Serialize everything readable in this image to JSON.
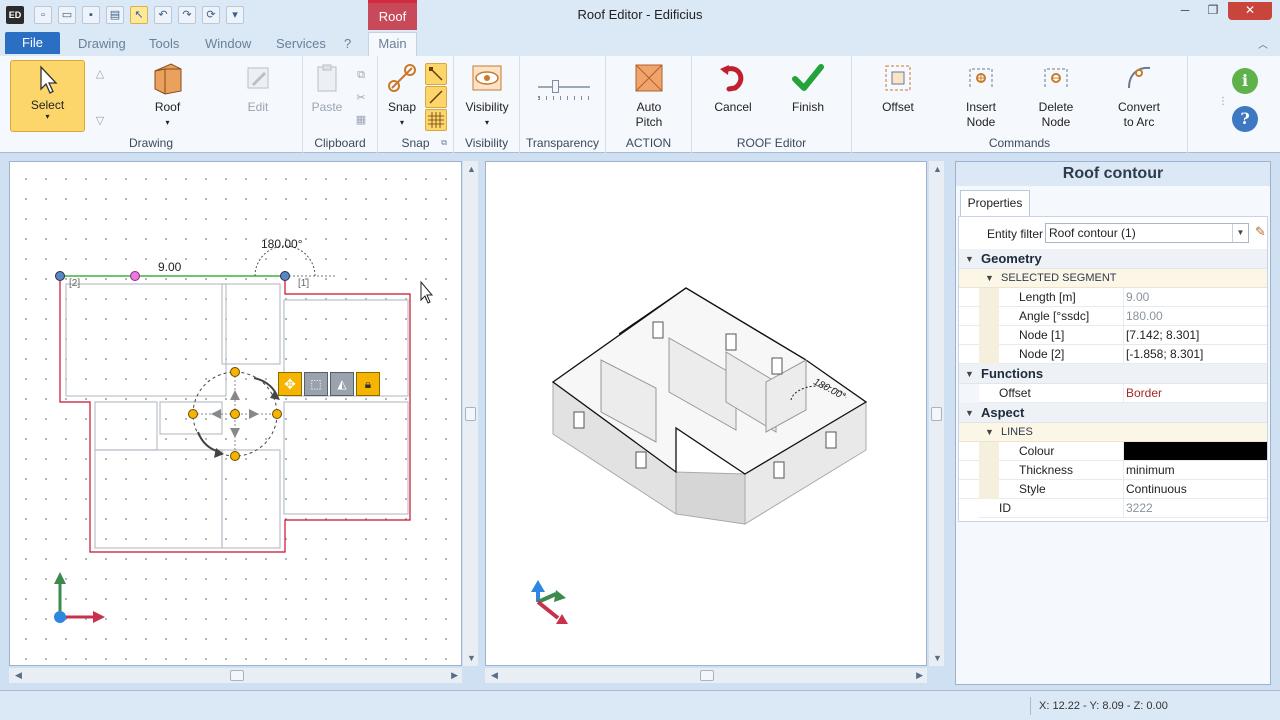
{
  "window": {
    "title": "Roof Editor - Edificius",
    "app_icon": "ED"
  },
  "context_tab": "Roof",
  "tabs": {
    "file": "File",
    "drawing": "Drawing",
    "tools": "Tools",
    "window": "Window",
    "services": "Services",
    "help": "?",
    "main": "Main"
  },
  "ribbon": {
    "select": "Select",
    "roof": "Roof",
    "edit": "Edit",
    "drawing_group": "Drawing",
    "paste": "Paste",
    "clipboard_group": "Clipboard",
    "snap": "Snap",
    "snap_group": "Snap",
    "visibility": "Visibility",
    "visibility_group": "Visibility",
    "transparency_group": "Transparency",
    "auto_pitch_1": "Auto",
    "auto_pitch_2": "Pitch",
    "action_group": "ACTION",
    "cancel": "Cancel",
    "finish": "Finish",
    "roof_editor_group": "ROOF Editor",
    "offset": "Offset",
    "insert_node_1": "Insert",
    "insert_node_2": "Node",
    "delete_node_1": "Delete",
    "delete_node_2": "Node",
    "convert_1": "Convert",
    "convert_2": "to Arc",
    "commands_group": "Commands"
  },
  "view2d": {
    "segment_length": "9.00",
    "angle": "180.00°",
    "node_label_1": "[1]",
    "node_label_2": "[2]"
  },
  "view3d": {
    "angle": "180.00°"
  },
  "properties": {
    "title": "Roof contour",
    "tab": "Properties",
    "entity_filter_label": "Entity filter",
    "entity_filter_value": "Roof contour (1)",
    "geometry": "Geometry",
    "selected_segment": "SELECTED SEGMENT",
    "length_label": "Length  [m]",
    "length_value": "9.00",
    "angle_label": "Angle  [°ssdc]",
    "angle_value": "180.00",
    "node1_label": "Node [1]",
    "node1_value": "[7.142; 8.301]",
    "node2_label": "Node [2]",
    "node2_value": "[-1.858; 8.301]",
    "functions": "Functions",
    "offset_label": "Offset",
    "offset_value": "Border",
    "aspect": "Aspect",
    "lines": "LINES",
    "colour_label": "Colour",
    "colour_value": "#000000",
    "thickness_label": "Thickness",
    "thickness_value": "minimum",
    "style_label": "Style",
    "style_value": "Continuous",
    "id_label": "ID",
    "id_value": "3222"
  },
  "status": {
    "coords": "X: 12.22 - Y: 8.09 - Z: 0.00"
  }
}
